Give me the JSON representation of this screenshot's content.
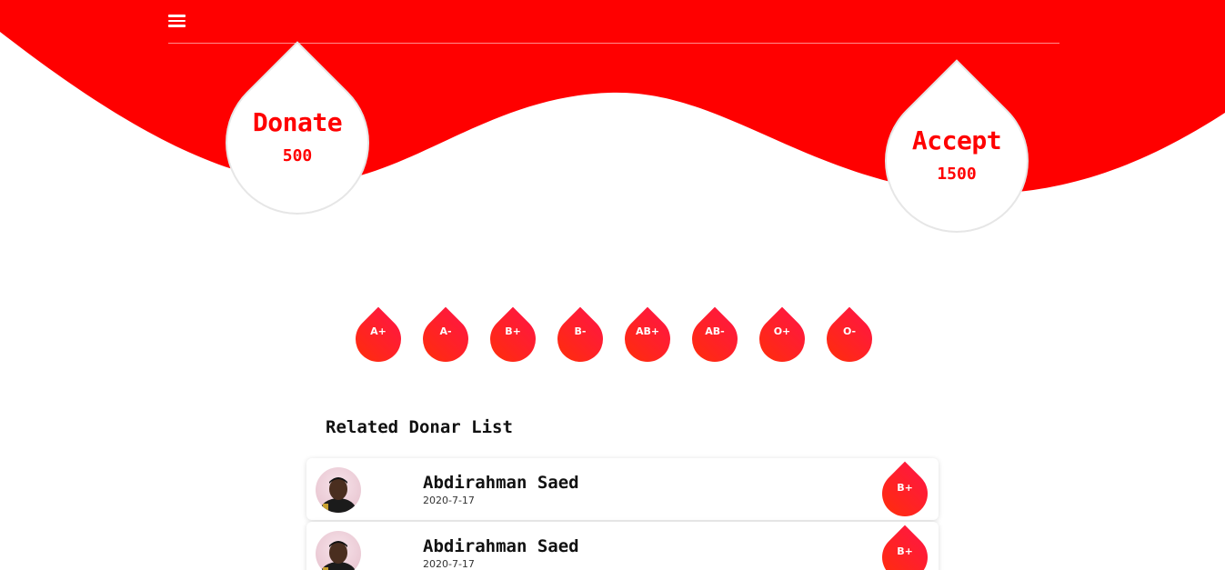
{
  "colors": {
    "accent": "#ff0000",
    "drop_gradient_top": "#ff1a3a",
    "drop_gradient_bottom": "#ff2a12"
  },
  "header": {
    "menu_icon": "hamburger-menu-icon"
  },
  "stats": {
    "donate": {
      "title": "Donate",
      "value": "500"
    },
    "accept": {
      "title": "Accept",
      "value": "1500"
    }
  },
  "blood_types": [
    "A+",
    "A-",
    "B+",
    "B-",
    "AB+",
    "AB-",
    "O+",
    "O-"
  ],
  "donor_list": {
    "title": "Related Donar List",
    "items": [
      {
        "name": "Abdirahman Saed",
        "date": "2020-7-17",
        "blood_type": "B+"
      },
      {
        "name": "Abdirahman Saed",
        "date": "2020-7-17",
        "blood_type": "B+"
      }
    ]
  }
}
